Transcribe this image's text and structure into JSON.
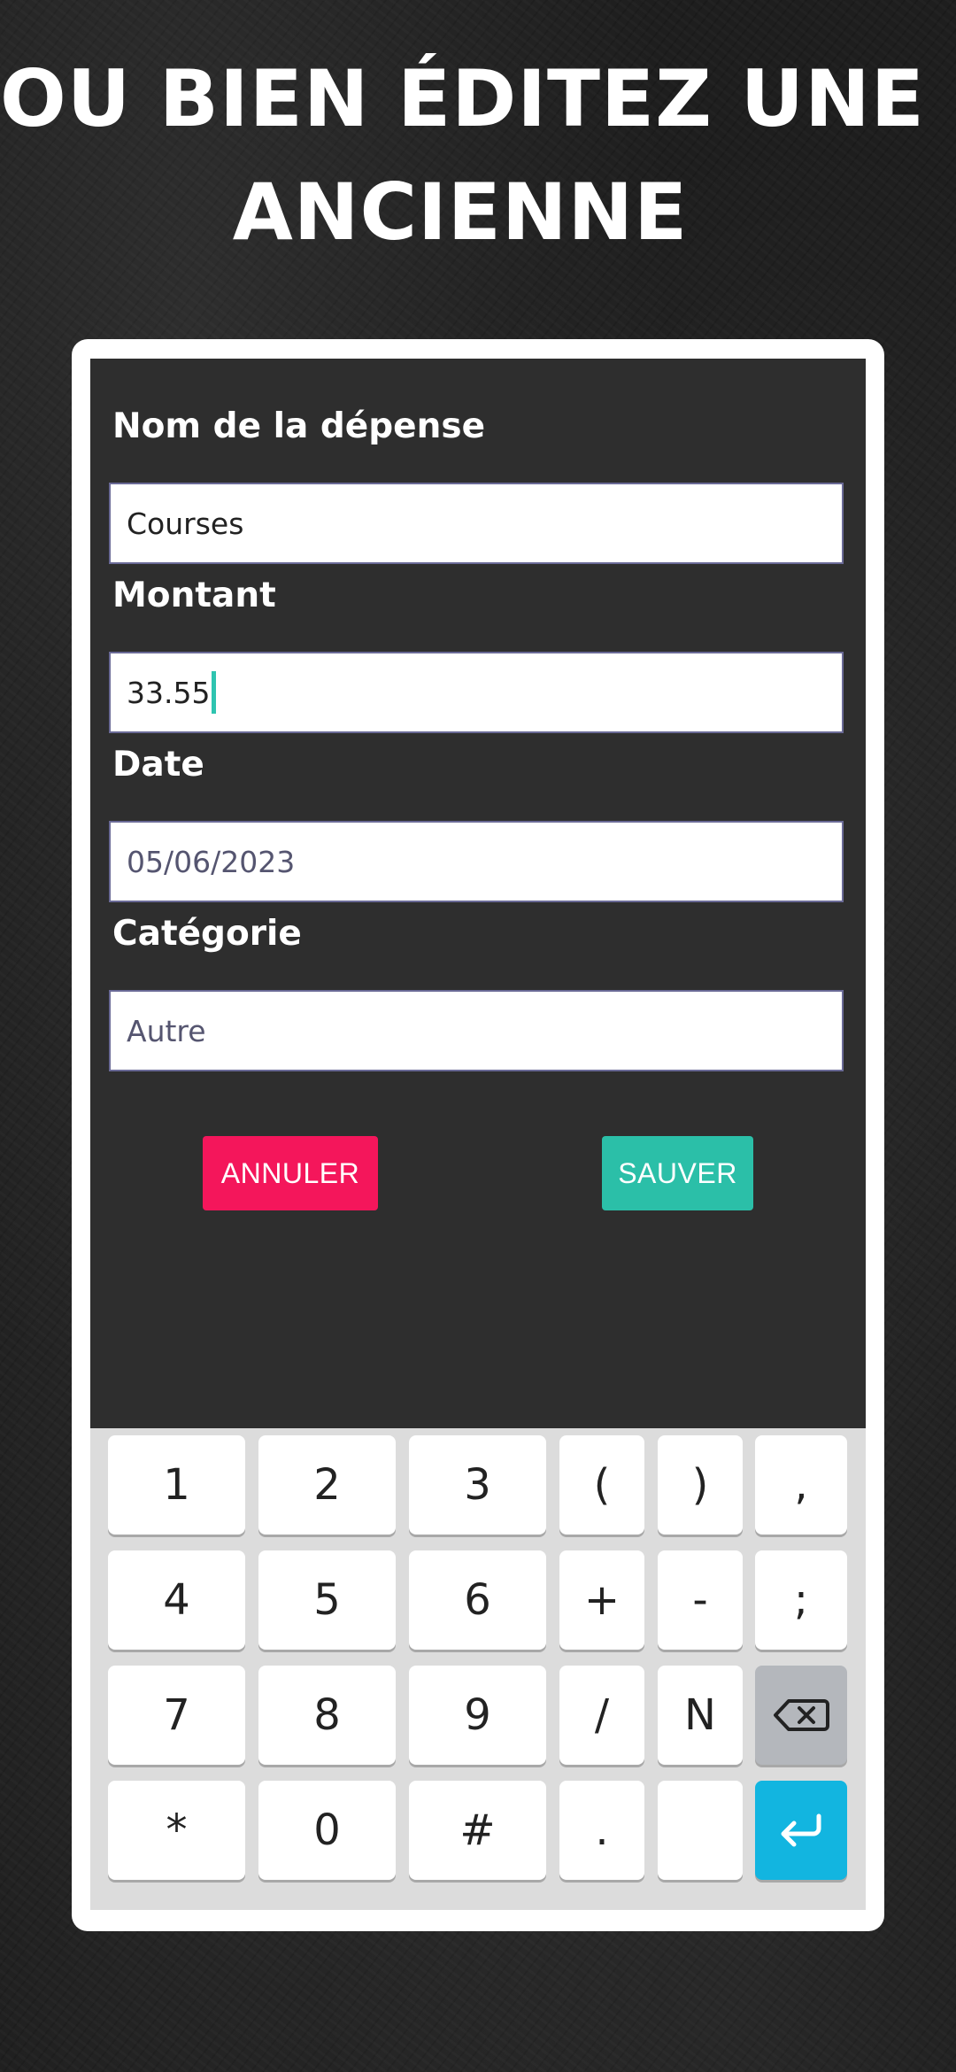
{
  "headline": {
    "line1": "OU BIEN ÉDITEZ UNE",
    "line2": "ANCIENNE"
  },
  "form": {
    "name_label": "Nom de la dépense",
    "name_value": "Courses",
    "amount_label": "Montant",
    "amount_value": "33.55",
    "date_label": "Date",
    "date_value": "05/06/2023",
    "category_label": "Catégorie",
    "category_value": "Autre"
  },
  "buttons": {
    "cancel_label": "ANNULER",
    "save_label": "SAUVER",
    "cancel_color": "#f4165b",
    "save_color": "#2bbfa8"
  },
  "keyboard": {
    "rows": [
      [
        "1",
        "2",
        "3",
        "(",
        ")",
        ","
      ],
      [
        "4",
        "5",
        "6",
        "+",
        "-",
        ";"
      ],
      [
        "7",
        "8",
        "9",
        "/",
        "N",
        "backspace-icon"
      ],
      [
        "*",
        "0",
        "#",
        ".",
        "",
        "enter-icon"
      ]
    ],
    "enter_color": "#12b5e0"
  }
}
